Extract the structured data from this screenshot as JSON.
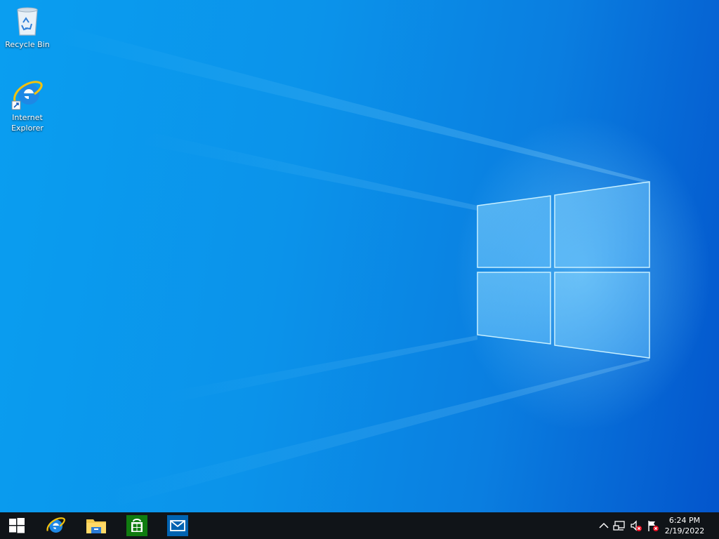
{
  "desktop": {
    "icons": [
      {
        "label": "Recycle Bin",
        "icon": "recycle-bin-icon"
      },
      {
        "label": "Internet Explorer",
        "icon": "internet-explorer-icon"
      }
    ]
  },
  "taskbar": {
    "start_icon": "windows-start-icon",
    "pinned": [
      {
        "name": "Internet Explorer",
        "icon": "internet-explorer-icon"
      },
      {
        "name": "File Explorer",
        "icon": "folder-icon"
      },
      {
        "name": "Store",
        "icon": "store-icon"
      },
      {
        "name": "Mail",
        "icon": "mail-icon"
      }
    ],
    "tray": {
      "icons": [
        "chevron-up-icon",
        "network-icon",
        "volume-muted-icon",
        "action-center-flag-icon"
      ]
    },
    "clock": {
      "time": "6:24 PM",
      "date": "2/19/2022"
    }
  },
  "colors": {
    "taskbar_bg": "#101418",
    "desktop_blue": "#0a9ef0",
    "ie_blue": "#1e88e5",
    "ie_ring": "#f4c20d",
    "store_green": "#107c10",
    "mail_blue": "#0063b1"
  }
}
